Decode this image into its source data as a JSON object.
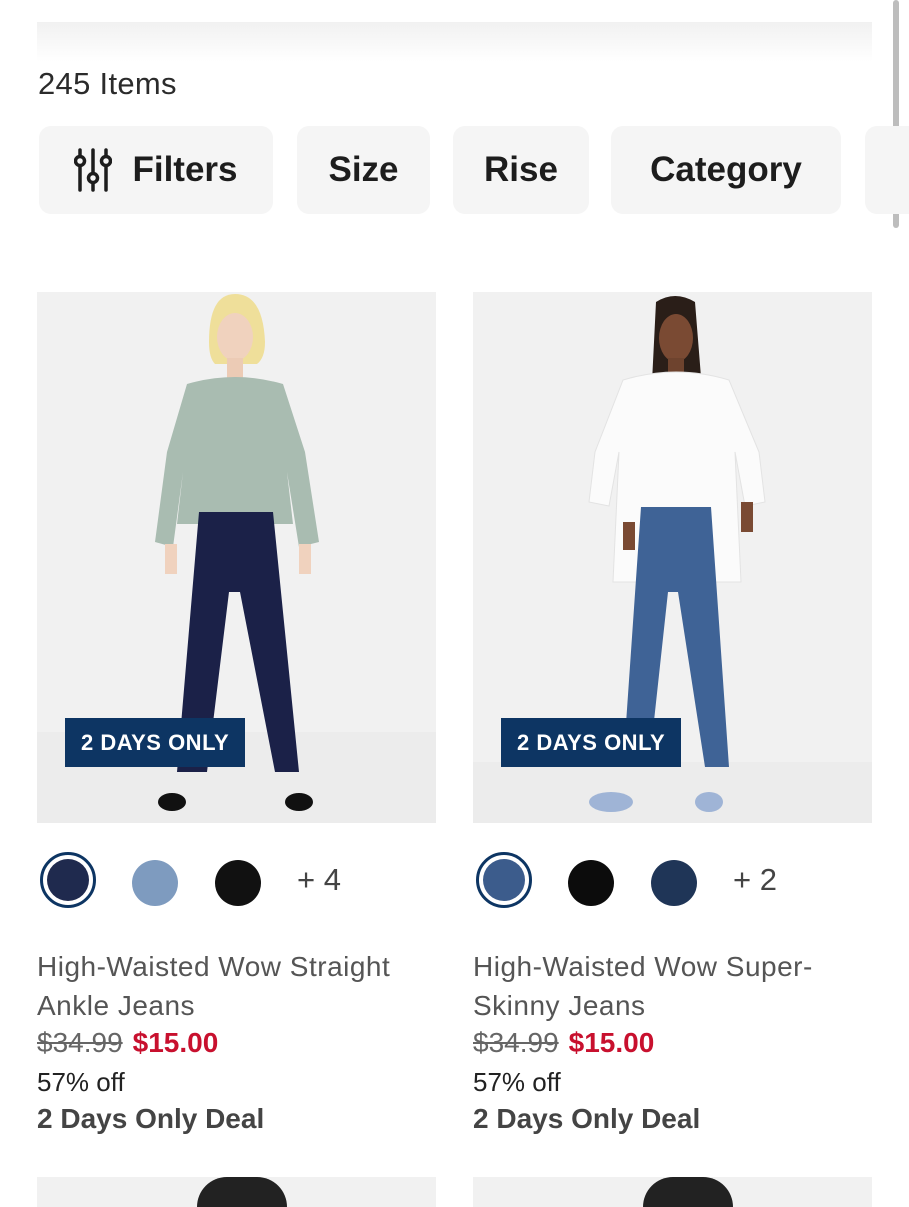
{
  "results": {
    "count_label": "245 Items"
  },
  "filters": {
    "chips": [
      {
        "label": "Filters",
        "icon": "sliders-icon"
      },
      {
        "label": "Size"
      },
      {
        "label": "Rise"
      },
      {
        "label": "Category"
      }
    ]
  },
  "products": [
    {
      "badge": "2 DAYS ONLY",
      "swatches": [
        {
          "color": "#1f2a4e",
          "selected": true
        },
        {
          "color": "#7e9bbf",
          "selected": false
        },
        {
          "color": "#111111",
          "selected": false
        }
      ],
      "more_colors": "+ 4",
      "title": "High-Waisted Wow Straight Ankle Jeans",
      "price_original": "$34.99",
      "price_sale": "$15.00",
      "discount": "57% off",
      "deal": "2 Days Only Deal"
    },
    {
      "badge": "2 DAYS ONLY",
      "swatches": [
        {
          "color": "#3c5c8c",
          "selected": true
        },
        {
          "color": "#0c0c0c",
          "selected": false
        },
        {
          "color": "#1f3557",
          "selected": false
        }
      ],
      "more_colors": "+ 2",
      "title": "High-Waisted Wow Super-Skinny Jeans",
      "price_original": "$34.99",
      "price_sale": "$15.00",
      "discount": "57% off",
      "deal": "2 Days Only Deal"
    }
  ],
  "colors": {
    "badge": "#0d3563",
    "sale": "#c8102e"
  }
}
